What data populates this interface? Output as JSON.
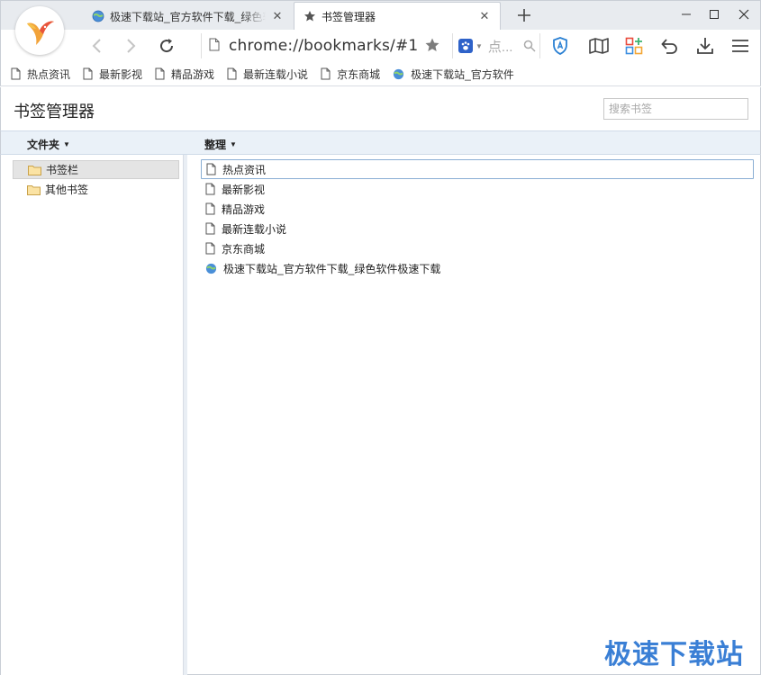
{
  "tabs": [
    {
      "title": "极速下载站_官方软件下载_绿色软件极速下载",
      "favicon": "globe-icon",
      "active": false
    },
    {
      "title": "书签管理器",
      "favicon": "star-icon",
      "active": true
    }
  ],
  "toolbar": {
    "url_scheme": "chrome://",
    "url_host": "bookmarks",
    "url_path": "/#1",
    "search_placeholder": "点...",
    "search_engine_icon": "baidu-paw-icon"
  },
  "bookmarks_bar": [
    {
      "label": "热点资讯",
      "icon": "page-icon"
    },
    {
      "label": "最新影视",
      "icon": "page-icon"
    },
    {
      "label": "精品游戏",
      "icon": "page-icon"
    },
    {
      "label": "最新连载小说",
      "icon": "page-icon"
    },
    {
      "label": "京东商城",
      "icon": "page-icon"
    },
    {
      "label": "极速下载站_官方软件",
      "icon": "globe-icon"
    }
  ],
  "page": {
    "title": "书签管理器",
    "search_placeholder": "搜索书签"
  },
  "columns": {
    "folders_menu": "文件夹",
    "organize_menu": "整理"
  },
  "folders": [
    {
      "label": "书签栏",
      "selected": true
    },
    {
      "label": "其他书签",
      "selected": false
    }
  ],
  "bookmarks": [
    {
      "label": "热点资讯",
      "icon": "page-icon"
    },
    {
      "label": "最新影视",
      "icon": "page-icon"
    },
    {
      "label": "精品游戏",
      "icon": "page-icon"
    },
    {
      "label": "最新连载小说",
      "icon": "page-icon"
    },
    {
      "label": "京东商城",
      "icon": "page-icon"
    },
    {
      "label": "极速下载站_官方软件下载_绿色软件极速下载",
      "icon": "globe-icon"
    }
  ],
  "watermark": "极速下载站",
  "colors": {
    "accent": "#3a7fd5",
    "header_bar": "#eaf1f8",
    "tab_strip": "#e8ebef"
  }
}
